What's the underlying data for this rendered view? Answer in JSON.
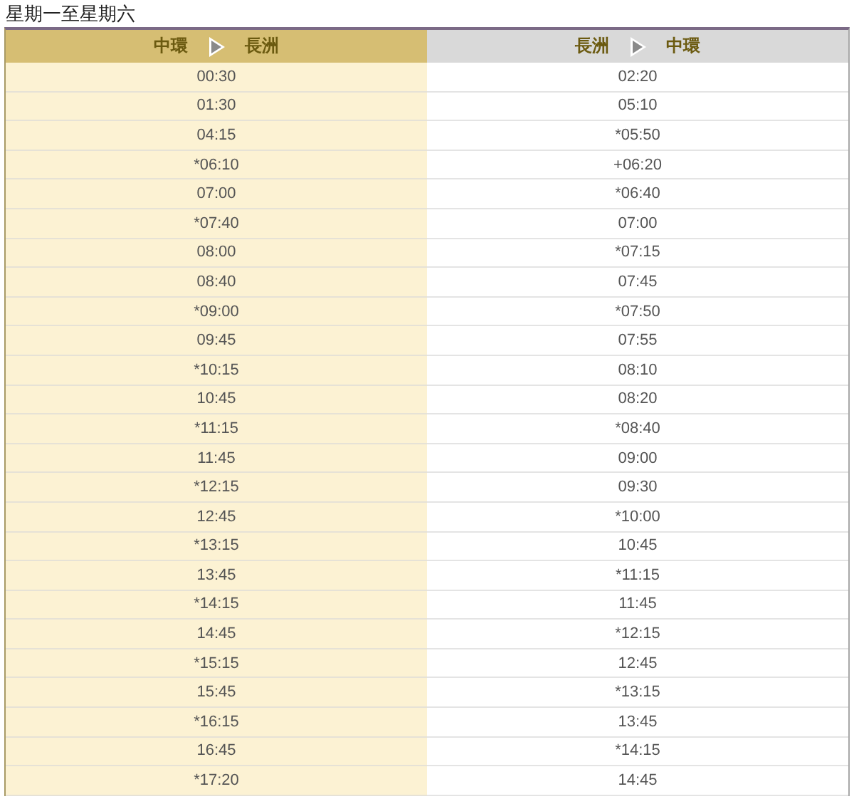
{
  "heading": "星期一至星期六",
  "columns": [
    {
      "from": "中環",
      "to": "長洲",
      "selected": true
    },
    {
      "from": "長洲",
      "to": "中環",
      "selected": false
    }
  ],
  "rows": [
    [
      "00:30",
      "02:20"
    ],
    [
      "01:30",
      "05:10"
    ],
    [
      "04:15",
      "*05:50"
    ],
    [
      "*06:10",
      "+06:20"
    ],
    [
      "07:00",
      "*06:40"
    ],
    [
      "*07:40",
      "07:00"
    ],
    [
      "08:00",
      "*07:15"
    ],
    [
      "08:40",
      "07:45"
    ],
    [
      "*09:00",
      "*07:50"
    ],
    [
      "09:45",
      "07:55"
    ],
    [
      "*10:15",
      "08:10"
    ],
    [
      "10:45",
      "08:20"
    ],
    [
      "*11:15",
      "*08:40"
    ],
    [
      "11:45",
      "09:00"
    ],
    [
      "*12:15",
      "09:30"
    ],
    [
      "12:45",
      "*10:00"
    ],
    [
      "*13:15",
      "10:45"
    ],
    [
      "13:45",
      "*11:15"
    ],
    [
      "*14:15",
      "11:45"
    ],
    [
      "14:45",
      "*12:15"
    ],
    [
      "*15:15",
      "12:45"
    ],
    [
      "15:45",
      "*13:15"
    ],
    [
      "*16:15",
      "13:45"
    ],
    [
      "16:45",
      "*14:15"
    ],
    [
      "*17:20",
      "14:45"
    ]
  ]
}
